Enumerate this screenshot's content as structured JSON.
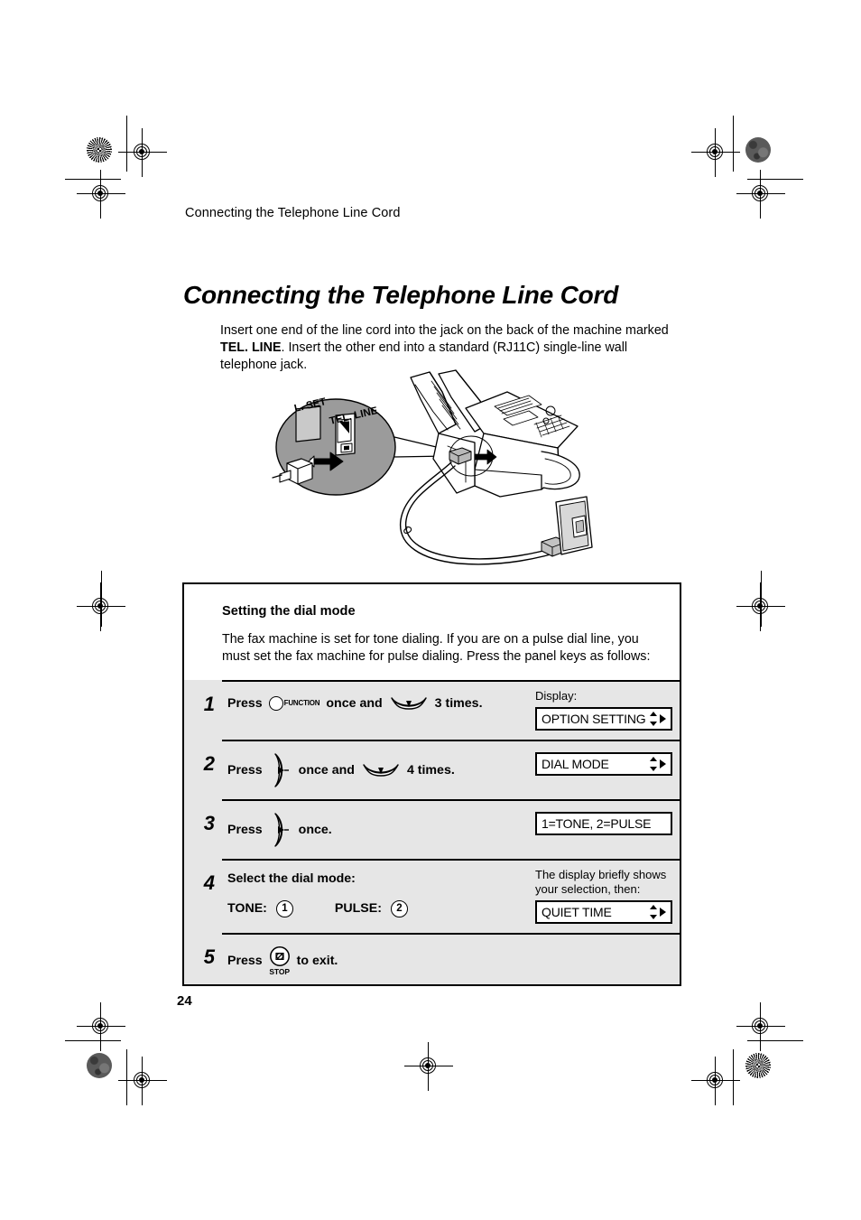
{
  "document": {
    "running_head": "Connecting the Telephone Line Cord",
    "title": "Connecting the Telephone Line Cord",
    "intro_before_bold": "Insert one end of the line cord into the jack on the back of the machine marked ",
    "intro_bold": "TEL. LINE",
    "intro_after_bold": ". Insert the other end into a standard (RJ11C) single-line wall telephone jack.",
    "page_number": "24"
  },
  "illustration": {
    "callout_label_left": "L. SET",
    "callout_label_right": "TEL. LINE",
    "alt": "Fax machine rear view with line cord plugged into TEL. LINE jack and other end into a wall telephone jack; magnified callout circle shows the jack panel."
  },
  "procedure": {
    "heading": "Setting the dial mode",
    "description": "The fax machine is set for tone dialing. If you are on a pulse dial line, you must set the fax machine for pulse dialing. Press the panel keys as follows:",
    "steps": [
      {
        "number": "1",
        "text_1": "Press",
        "key_1": "function-key",
        "key_1_label": "FUNCTION",
        "text_2": "once and",
        "key_2": "down-arrow-key",
        "text_3": "3 times.",
        "right_caption": "Display:",
        "lcd": "OPTION SETTING",
        "lcd_arrows": "up-down-right-arrows"
      },
      {
        "number": "2",
        "text_1": "Press",
        "key_1": "right-arrow-key",
        "text_2": "once and",
        "key_2": "down-arrow-key",
        "text_3": "4 times.",
        "right_caption": "",
        "lcd": "DIAL MODE",
        "lcd_arrows": "up-down-right-arrows"
      },
      {
        "number": "3",
        "text_1": "Press",
        "key_1": "right-arrow-key",
        "text_2": "once.",
        "right_caption": "",
        "lcd": "1=TONE, 2=PULSE",
        "lcd_arrows": "none"
      },
      {
        "number": "4",
        "text_1": "Select the dial mode:",
        "tone_label": "TONE:",
        "tone_key": "1",
        "pulse_label": "PULSE:",
        "pulse_key": "2",
        "right_caption": "The display briefly shows your selection, then:",
        "lcd": "QUIET TIME",
        "lcd_arrows": "up-down-right-arrows"
      },
      {
        "number": "5",
        "text_1": "Press",
        "key_1": "stop-key",
        "key_1_label": "STOP",
        "text_2": "to exit.",
        "right_caption": "",
        "lcd": "",
        "lcd_arrows": "none"
      }
    ]
  },
  "colors": {
    "step_row_background": "#e6e6e6",
    "header_background": "#ffffff",
    "border": "#000000",
    "callout_fill": "#9b9b9b"
  }
}
